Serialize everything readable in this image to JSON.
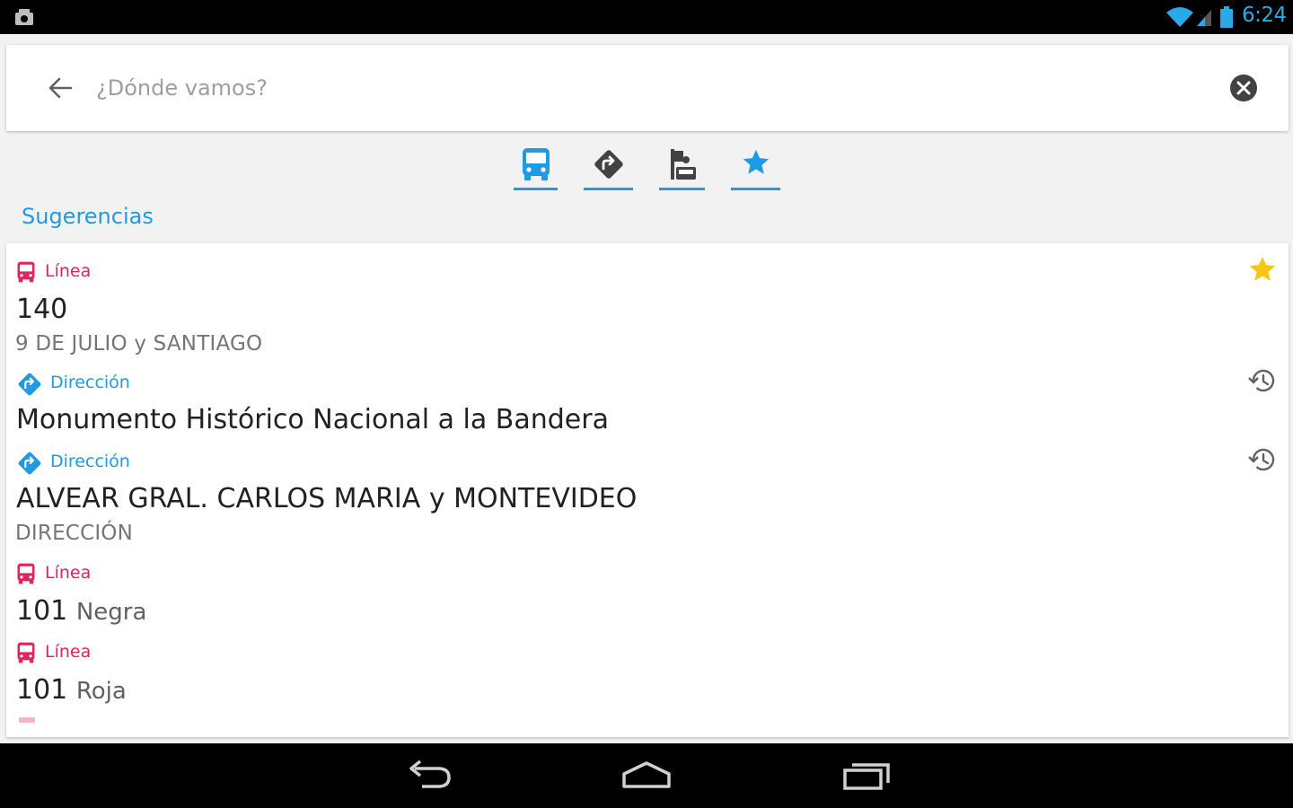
{
  "status_bar": {
    "clock": "6:24",
    "icons": [
      "notification-icon",
      "wifi-icon",
      "signal-icon",
      "battery-icon"
    ],
    "accent_color": "#29a9e8"
  },
  "search": {
    "placeholder": "¿Dónde vamos?",
    "value": ""
  },
  "filter_tabs": [
    {
      "icon": "bus-icon",
      "selected": true
    },
    {
      "icon": "direction-icon",
      "selected": true
    },
    {
      "icon": "stop-icon",
      "selected": true
    },
    {
      "icon": "star-icon",
      "selected": true
    }
  ],
  "section_title": "Sugerencias",
  "colors": {
    "accent": "#1e9be3",
    "linea": "#e0245e",
    "favorite": "#f5c518"
  },
  "suggestions": [
    {
      "type_label": "Línea",
      "type_icon": "bus-icon",
      "title": "140",
      "suffix": "",
      "subtitle": "9 DE JULIO y SANTIAGO",
      "action_icon": "star-icon"
    },
    {
      "type_label": "Dirección",
      "type_icon": "direction-icon",
      "title": "Monumento Histórico Nacional a la Bandera",
      "suffix": "",
      "subtitle": "",
      "action_icon": "history-icon"
    },
    {
      "type_label": "Dirección",
      "type_icon": "direction-icon",
      "title": "ALVEAR  GRAL. CARLOS MARIA y MONTEVIDEO",
      "suffix": "",
      "subtitle": "DIRECCIÓN",
      "action_icon": "history-icon"
    },
    {
      "type_label": "Línea",
      "type_icon": "bus-icon",
      "title": "101",
      "suffix": "Negra",
      "subtitle": "",
      "action_icon": ""
    },
    {
      "type_label": "Línea",
      "type_icon": "bus-icon",
      "title": "101",
      "suffix": "Roja",
      "subtitle": "",
      "action_icon": ""
    }
  ],
  "nav_bar": [
    "back-icon",
    "home-icon",
    "recents-icon"
  ]
}
